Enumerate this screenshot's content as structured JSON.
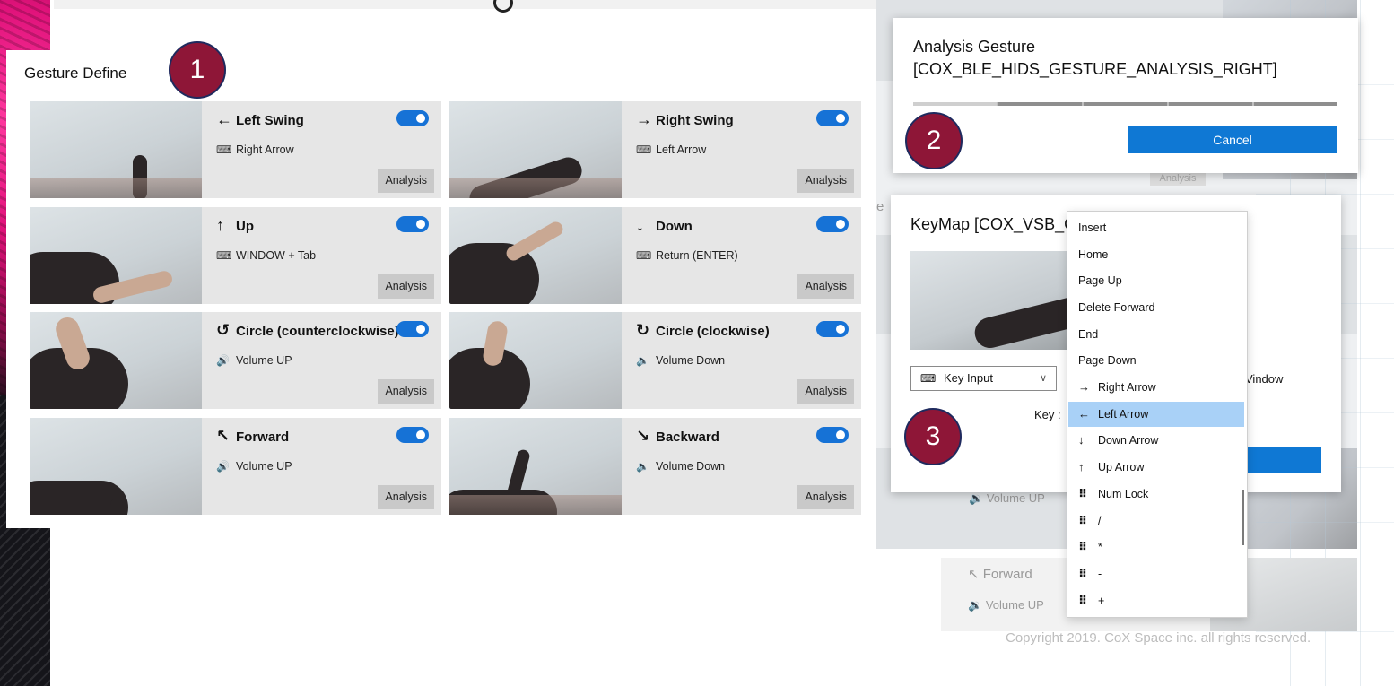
{
  "gesture_panel": {
    "title": "Gesture Define",
    "badge": "1",
    "cards": [
      {
        "name": "Left Swing",
        "gesture_icon": "←",
        "sub_icon": "keyboard-icon",
        "sub": "Right Arrow",
        "enabled": true,
        "button": "Analysis"
      },
      {
        "name": "Right Swing",
        "gesture_icon": "→",
        "sub_icon": "keyboard-icon",
        "sub": "Left Arrow",
        "enabled": true,
        "button": "Analysis"
      },
      {
        "name": "Up",
        "gesture_icon": "↑",
        "sub_icon": "keyboard-icon",
        "sub": "WINDOW + Tab",
        "enabled": true,
        "button": "Analysis"
      },
      {
        "name": "Down",
        "gesture_icon": "↓",
        "sub_icon": "keyboard-icon",
        "sub": "Return (ENTER)",
        "enabled": true,
        "button": "Analysis"
      },
      {
        "name": "Circle (counterclockwise)",
        "gesture_icon": "↺",
        "sub_icon": "volume-up-icon",
        "sub": "Volume UP",
        "enabled": true,
        "button": "Analysis"
      },
      {
        "name": "Circle (clockwise)",
        "gesture_icon": "↻",
        "sub_icon": "volume-down-icon",
        "sub": "Volume Down",
        "enabled": true,
        "button": "Analysis"
      },
      {
        "name": "Forward",
        "gesture_icon": "↖",
        "sub_icon": "volume-up-icon",
        "sub": "Volume UP",
        "enabled": true,
        "button": "Analysis"
      },
      {
        "name": "Backward",
        "gesture_icon": "↘",
        "sub_icon": "volume-down-icon",
        "sub": "Volume Down",
        "enabled": true,
        "button": "Analysis"
      }
    ]
  },
  "analysis_dialog": {
    "line1": "Analysis Gesture",
    "line2": "[COX_BLE_HIDS_GESTURE_ANALYSIS_RIGHT]",
    "badge": "2",
    "cancel": "Cancel",
    "background_button": "Analysis"
  },
  "keymap_dialog": {
    "title": "KeyMap [COX_VSB_GE",
    "badge": "3",
    "input_type": "Key Input",
    "key_label": "Key :",
    "window_text": "Vindow",
    "edge_letter": "e"
  },
  "dropdown": {
    "items": [
      {
        "icon": "",
        "label": "Insert"
      },
      {
        "icon": "",
        "label": "Home"
      },
      {
        "icon": "",
        "label": "Page Up"
      },
      {
        "icon": "",
        "label": "Delete Forward"
      },
      {
        "icon": "",
        "label": "End"
      },
      {
        "icon": "",
        "label": "Page Down"
      },
      {
        "icon": "→",
        "label": "Right Arrow"
      },
      {
        "icon": "←",
        "label": "Left Arrow",
        "selected": true
      },
      {
        "icon": "↓",
        "label": "Down Arrow"
      },
      {
        "icon": "↑",
        "label": "Up Arrow"
      },
      {
        "icon": "⠿",
        "label": "Num Lock"
      },
      {
        "icon": "⠿",
        "label": "/"
      },
      {
        "icon": "⠿",
        "label": "*"
      },
      {
        "icon": "⠿",
        "label": "-"
      },
      {
        "icon": "⠿",
        "label": "+"
      }
    ]
  },
  "background": {
    "volume_up": "Volume UP",
    "forward": "Forward",
    "volume_up_2": "Volume UP"
  },
  "footer": {
    "copyright": "Copyright 2019. CoX Space inc. all rights reserved."
  },
  "colors": {
    "badge": "#8e1637",
    "toggle": "#1672d6",
    "primary_button": "#0f78d4",
    "selected_item": "#a9d1f7"
  }
}
